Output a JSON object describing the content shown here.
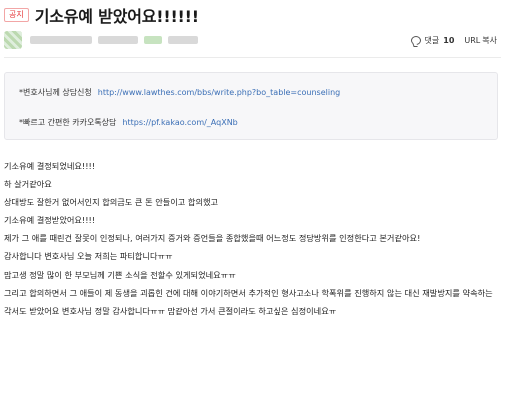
{
  "header": {
    "badge": "공지",
    "title": "기소유예 받았어요!!!!!!"
  },
  "meta": {
    "comment_label": "댓글",
    "comment_count": "10",
    "url_label": "URL",
    "copy_label": "복사"
  },
  "info": {
    "line1_label": "*변호사님께 상담신청",
    "line1_link": "http://www.lawthes.com/bbs/write.php?bo_table=counseling",
    "line2_label": "*빠르고 간편한 카카오톡상담",
    "line2_link": "https://pf.kakao.com/_AqXNb"
  },
  "content": {
    "lines": [
      "기소유예 결정되었네요!!!!",
      "하 살거같아요",
      "상대방도 잘한거 없어서인지 합의금도 큰 돈 안들이고 합의했고",
      "기소유예 결정받았어요!!!!",
      "제가 그 애를 때린건 잘못이 인정되나, 여러가지 증거와 증언들을 종합했을때 어느정도 정당방위를 인정한다고 본거같아요!",
      "감사합니다 변호사님 오늘 저희는 파티합니다ㅠㅠ",
      "맘고생 정말 많이 한 부모님께 기쁜 소식을 전할수 있게되었네요ㅠㅠ",
      "그리고 합의하면서 그 애들이 제 동생을 괴롭힌 건에 대해 이야기하면서 추가적인 형사고소나 학폭위를 진행하지 않는 대신 재발방지를 약속하는 각서도 받았어요 변호사님 정말 감사합니다ㅠㅠ 맘같아선 가서 큰절이라도 하고싶은 심정이네요ㅠ"
    ]
  }
}
